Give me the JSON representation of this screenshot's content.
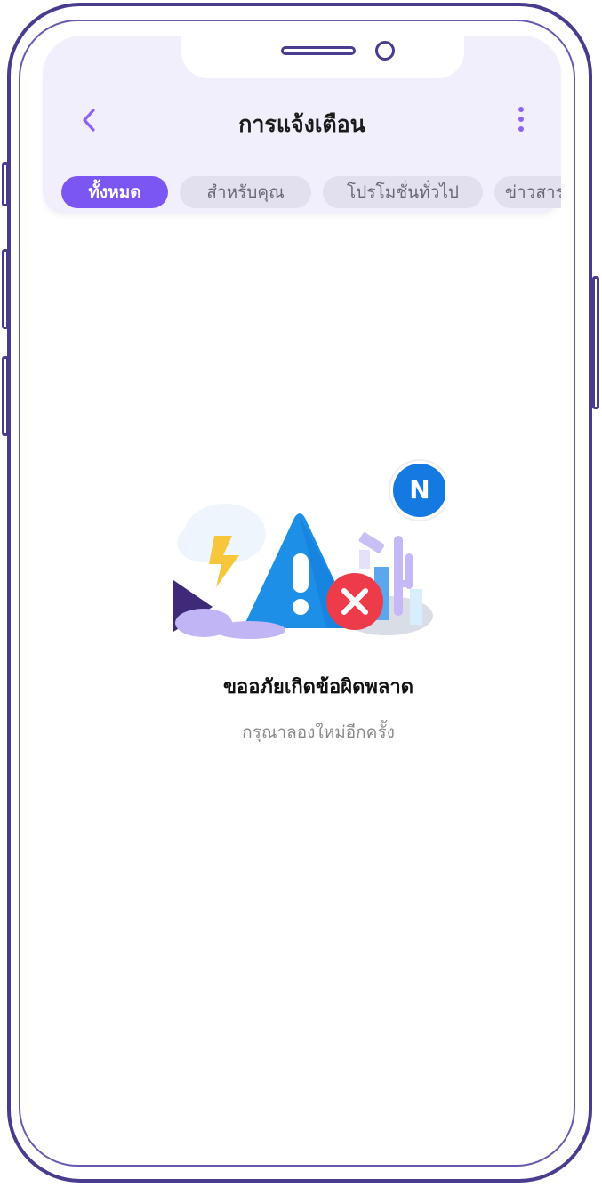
{
  "header": {
    "title": "การแจ้งเตือน"
  },
  "tabs": [
    {
      "label": "ทั้งหมด",
      "active": true
    },
    {
      "label": "สำหรับคุณ",
      "active": false
    },
    {
      "label": "โปรโมชั่นทั่วไป",
      "active": false
    },
    {
      "label": "ข่าวสาร",
      "active": false
    }
  ],
  "illustration": {
    "badge_letter": "N"
  },
  "error": {
    "title": "ขออภัยเกิดข้อผิดพลาด",
    "subtitle": "กรุณาลองใหม่อีกครั้ง"
  },
  "colors": {
    "frame": "#4a3b8f",
    "accent": "#7c56f2",
    "header_bg": "#f1effb",
    "tab_bg": "#e2dfee",
    "warning_blue": "#1e8fe6",
    "error_red": "#ee3b4a"
  }
}
